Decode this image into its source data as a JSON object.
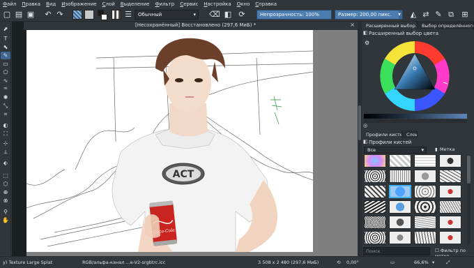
{
  "menu": {
    "items": [
      {
        "label": "Файл",
        "ul": "Ф",
        "rest": "айл"
      },
      {
        "label": "Правка",
        "ul": "П",
        "rest": "равка"
      },
      {
        "label": "Вид",
        "ul": "В",
        "rest": "ид"
      },
      {
        "label": "Изображение",
        "ul": "И",
        "rest": "зображение"
      },
      {
        "label": "Слой",
        "ul": "С",
        "rest": "лой"
      },
      {
        "label": "Выделение",
        "ul": "В",
        "rest": "ыделение"
      },
      {
        "label": "Фильтр",
        "ul": "Ф",
        "rest": "ильтр"
      },
      {
        "label": "Сервис",
        "ul": "С",
        "rest": "ервис"
      },
      {
        "label": "Настройка",
        "ul": "Н",
        "rest": "астройка"
      },
      {
        "label": "Окно",
        "ul": "О",
        "rest": "кно"
      },
      {
        "label": "Справка",
        "ul": "С",
        "rest": "правка"
      }
    ]
  },
  "toolbar": {
    "blend_mode": "Обычный",
    "opacity_label": "Непрозрачность: 100%",
    "opacity_value": 1.0,
    "size_label": "Размер: 200,00 пикс.",
    "size_fraction": 0.95,
    "fg_color": "#1a1a1a",
    "bg_color": "#ffffff"
  },
  "document": {
    "tab_title": "[Несохранённый]  Восстановлено  (297,6 МиБ)  *",
    "logo_text": "ACT",
    "can_text": "Coca-Cola"
  },
  "dock": {
    "tabs": [
      "Расширенный выбор...",
      "Выбор определённого ..."
    ],
    "color_panel_title": "Расширенный выбор цвета",
    "brush_tabs": [
      "Профили кистей",
      "Слои"
    ],
    "brush_panel_title": "Профили кистей",
    "brush_filter": "Все",
    "tag_label": "Метка",
    "search_placeholder": "Поиск",
    "filter_by_tag": "Фильтр по метке"
  },
  "status": {
    "brush_name": "y) Texture Large Splat",
    "color_profile": "RGB/альфа-канал ...e-V2-srgbtrc.icc",
    "dimensions": "3 508 x 2 480 (297,6 МиБ)",
    "rotation": "0,00°",
    "zoom": "66,6%"
  },
  "colors": {
    "accent": "#3daee9",
    "selection": "#3d6690",
    "panel": "#31363b",
    "dark": "#1d2023"
  }
}
